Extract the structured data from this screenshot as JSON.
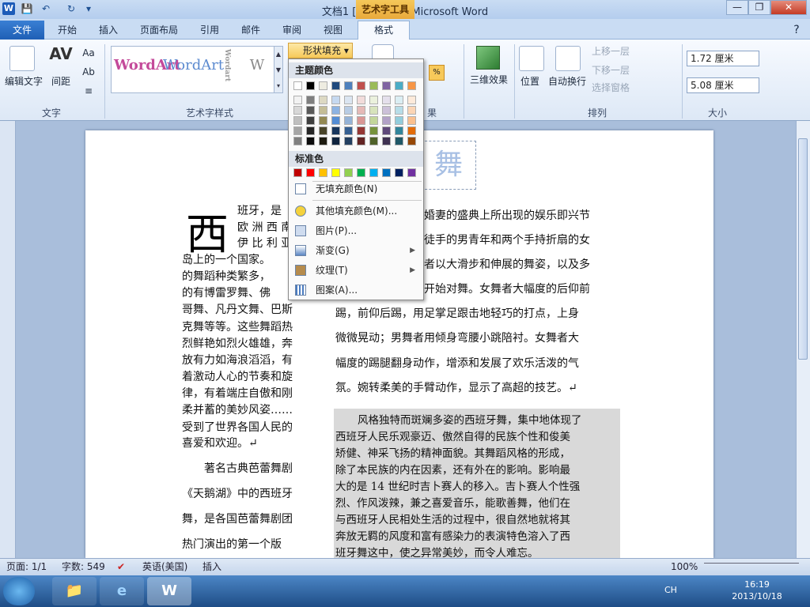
{
  "window": {
    "title": "文档1 [兼容模式] - Microsoft Word",
    "context_tab": "艺术字工具"
  },
  "qat": {
    "word_logo": "W",
    "save": "💾",
    "undo": "↶",
    "redo": "↻",
    "customize": "▾"
  },
  "window_controls": {
    "minimize": "—",
    "restore": "❐",
    "close": "✕"
  },
  "tabs": [
    "文件",
    "开始",
    "插入",
    "页面布局",
    "引用",
    "邮件",
    "审阅",
    "视图",
    "格式"
  ],
  "active_tab": "格式",
  "ribbon": {
    "text_group": {
      "label": "文字",
      "edit_text": "编辑文字",
      "spacing": "间距",
      "even_height": "Aa",
      "vertical": "Ab",
      "align": "≡"
    },
    "wordart_styles": {
      "label": "艺术字样式",
      "samples": [
        "WordArt",
        "WordArt",
        "Wordart",
        "W"
      ],
      "shape_fill": "形状填充"
    },
    "effects_3d": "三维效果",
    "arrange": {
      "label": "排列",
      "position": "位置",
      "wrap": "自动换行",
      "bring_forward": "上移一层",
      "send_backward": "下移一层",
      "selection_pane": "选择窗格"
    },
    "size": {
      "label": "大小",
      "height": "1.72 厘米",
      "width": "5.08 厘米"
    },
    "partial_label": "果"
  },
  "shape_fill_menu": {
    "theme_colors_label": "主题颜色",
    "standard_colors_label": "标准色",
    "theme_top": [
      "#ffffff",
      "#000000",
      "#eeece1",
      "#1f497d",
      "#4f81bd",
      "#c0504d",
      "#9bbb59",
      "#8064a2",
      "#4bacc6",
      "#f79646"
    ],
    "theme_shades": [
      [
        "#f2f2f2",
        "#7f7f7f",
        "#ddd9c3",
        "#c6d9f0",
        "#dbe5f1",
        "#f2dcdb",
        "#ebf1dd",
        "#e5e0ec",
        "#dbeef3",
        "#fdeada"
      ],
      [
        "#d8d8d8",
        "#595959",
        "#c4bd97",
        "#8db3e2",
        "#b8cce4",
        "#e5b9b7",
        "#d7e3bc",
        "#ccc1d9",
        "#b7dde8",
        "#fbd5b5"
      ],
      [
        "#bfbfbf",
        "#3f3f3f",
        "#938953",
        "#548dd4",
        "#95b3d7",
        "#d99694",
        "#c3d69b",
        "#b2a2c7",
        "#92cddc",
        "#fac08f"
      ],
      [
        "#a5a5a5",
        "#262626",
        "#494429",
        "#17365d",
        "#366092",
        "#953734",
        "#76923c",
        "#5f497a",
        "#31859b",
        "#e36c09"
      ],
      [
        "#7f7f7f",
        "#0c0c0c",
        "#1d1b10",
        "#0f243e",
        "#244061",
        "#632423",
        "#4f6128",
        "#3f3151",
        "#205867",
        "#974806"
      ]
    ],
    "standard": [
      "#c00000",
      "#ff0000",
      "#ffc000",
      "#ffff00",
      "#92d050",
      "#00b050",
      "#00b0f0",
      "#0070c0",
      "#002060",
      "#7030a0"
    ],
    "items": [
      "无填充颜色(N)",
      "其他填充颜色(M)...",
      "图片(P)...",
      "渐变(G)",
      "纹理(T)",
      "图案(A)..."
    ]
  },
  "document": {
    "dropcap": "西",
    "wordart_text": "舞",
    "left_col": [
      "班牙，是",
      "欧 洲 西 南",
      "伊 比 利 亚",
      "岛上的一个国家。",
      "的舞蹈种类繁多，",
      "的有博雷罗舞、佛",
      "哥舞、凡丹文舞、巴斯",
      "克舞等等。这些舞蹈热",
      "烈鲜艳如烈火雄雄，奔",
      "放有力如海浪滔滔，有",
      "着激动人心的节奏和旋",
      "律，有着端庄自傲和刚",
      "柔并蓄的美妙风姿……",
      "受到了世界各国人民的",
      "喜爱和欢迎。↵",
      "著名古典芭蕾舞剧",
      "《天鹅湖》中的西班牙",
      "舞，是各国芭蕾舞剧团",
      "热门演出的第一个版"
    ],
    "right_col": [
      "婚妻的盛典上所出现的娱乐即兴节",
      "徒手的男青年和两个手持折扇的女",
      "者以大滑步和伸展的舞姿，以及多",
      "开始对舞。女舞者大幅度的后仰前",
      "踢，前仰后踢，用足掌足跟击地轻巧的打点，上身",
      "微微晃动；男舞者用倾身弯腰小跳陪衬。女舞者大",
      "幅度的踢腿翻身动作，增添和发展了欢乐活泼的气",
      "氛。婉转柔美的手臂动作，显示了高超的技艺。↵"
    ],
    "highlighted": [
      "风格独特而斑斓多姿的西班牙舞，集中地体现了",
      "西班牙人民乐观豪迈、傲然自得的民族个性和俊美",
      "矫健、神采飞扬的精神面貌。其舞蹈风格的形成，",
      "除了本民族的内在因素，还有外在的影响。影响最",
      "大的是 14 世纪时吉卜赛人的移入。吉卜赛人个性强",
      "烈、作风泼辣，兼之喜爱音乐，能歌善舞，他们在",
      "与西班牙人民相处生活的过程中，很自然地就将其",
      "奔放无羁的风度和富有感染力的表演特色溶入了西",
      "班牙舞这中，使之异常美妙，而令人难忘。"
    ]
  },
  "status": {
    "page": "页面: 1/1",
    "words": "字数: 549",
    "language": "英语(美国)",
    "mode": "插入",
    "zoom": "100%"
  },
  "taskbar": {
    "lang": "CH",
    "time": "16:19",
    "date": "2013/10/18"
  }
}
